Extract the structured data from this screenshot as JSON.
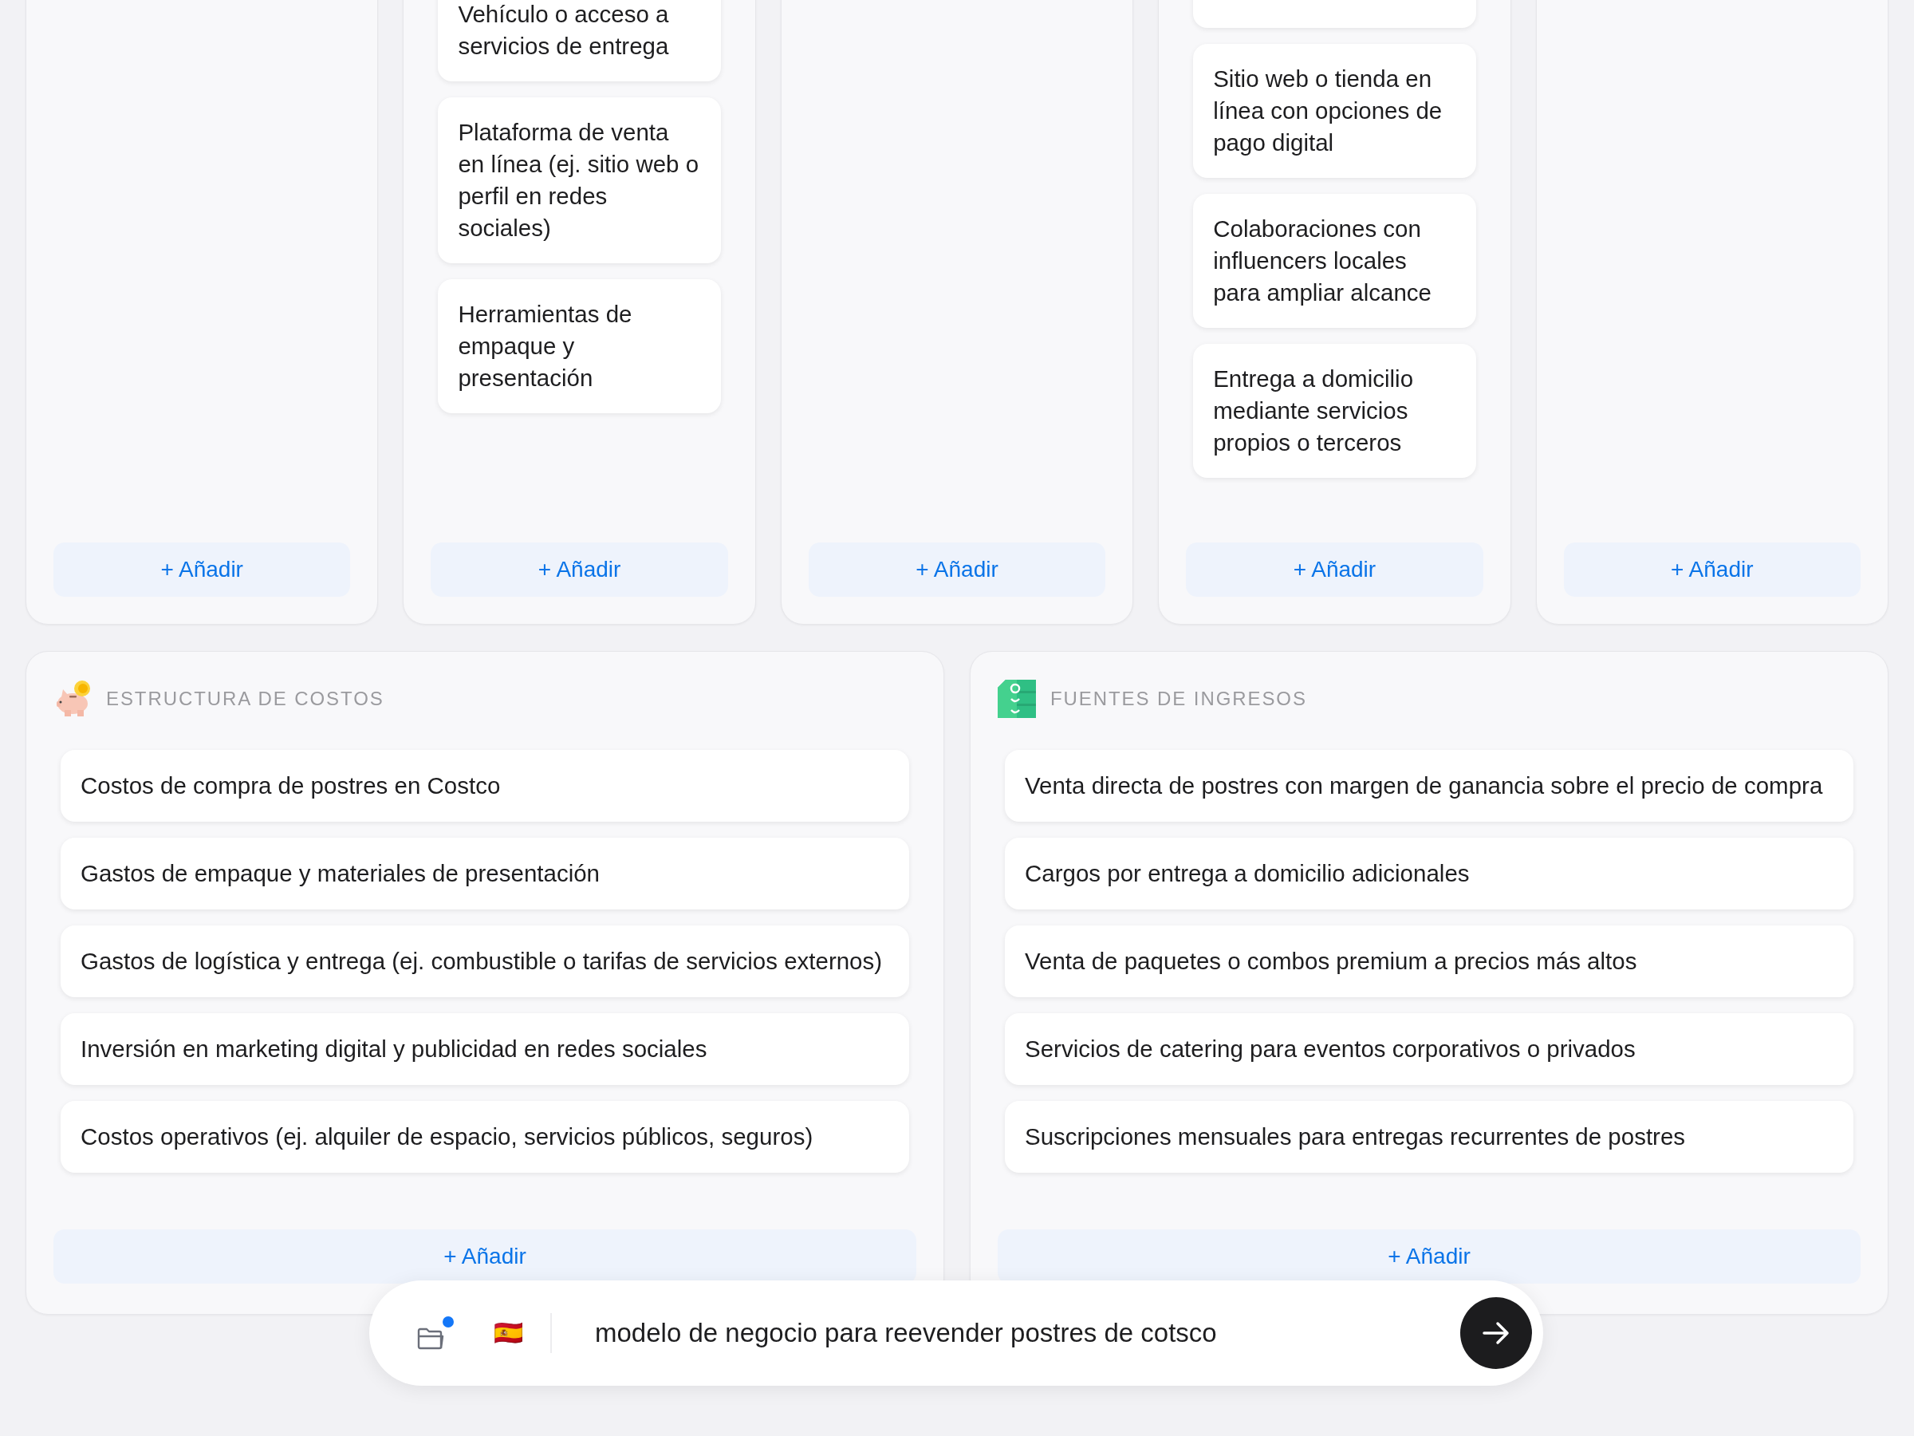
{
  "top_columns": [
    {
      "add_button": "+ Añadir"
    },
    {
      "cards": [
        {
          "text": "Vehículo o acceso a servicios de entrega"
        },
        {
          "text": "Plataforma de venta en línea (ej. sitio web o perfil en redes sociales)"
        },
        {
          "text": "Herramientas de empaque y presentación"
        }
      ],
      "add_button": "+ Añadir"
    },
    {
      "add_button": "+ Añadir"
    },
    {
      "cards": [
        {
          "kind": "cut"
        },
        {
          "text": "Sitio web o tienda en línea con opciones de pago digital"
        },
        {
          "text": "Colaboraciones con influencers locales para ampliar alcance"
        },
        {
          "text": "Entrega a domicilio mediante servicios propios o terceros"
        }
      ],
      "add_button": "+ Añadir"
    },
    {
      "add_button": "+ Añadir"
    }
  ],
  "bottom_sections": [
    {
      "kind": "costs",
      "title": "ESTRUCTURA DE COSTOS",
      "items": [
        "Costos de compra de postres en Costco",
        "Gastos de empaque y materiales de presentación",
        "Gastos de logística y entrega (ej. combustible o tarifas de servicios externos)",
        "Inversión en marketing digital y publicidad en redes sociales",
        "Costos operativos (ej. alquiler de espacio, servicios públicos, seguros)"
      ],
      "add_button": "+ Añadir"
    },
    {
      "kind": "revenue",
      "title": "FUENTES DE INGRESOS",
      "items": [
        "Venta directa de postres con margen de ganancia sobre el precio de compra",
        "Cargos por entrega a domicilio adicionales",
        "Venta de paquetes o combos premium a precios más altos",
        "Servicios de catering para eventos corporativos o privados",
        "Suscripciones mensuales para entregas recurrentes de postres"
      ],
      "add_button": "+ Añadir"
    }
  ],
  "prompt_bar": {
    "attachment_badge": true,
    "flag": "🇪🇸",
    "value": "modelo de negocio para reevender postres de cotsco"
  }
}
